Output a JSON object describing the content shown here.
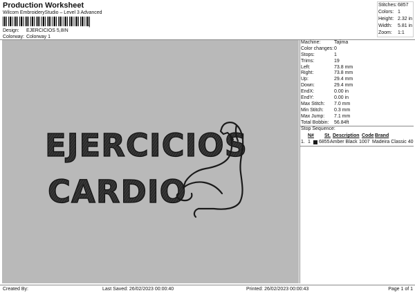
{
  "header": {
    "title": "Production Worksheet",
    "subtitle": "Wilcom EmbroideryStudio – Level 3 Advanced",
    "barcode_mark": ",",
    "design_label": "Design:",
    "design_value": "EJERCICIOS 5,8IN",
    "colorway_label": "Colorway:",
    "colorway_value": "Colorway 1"
  },
  "top_stats": [
    {
      "label": "Stitches:",
      "value": "6857"
    },
    {
      "label": "Colors:",
      "value": "1"
    },
    {
      "label": "Height:",
      "value": "2.32 in"
    },
    {
      "label": "Width:",
      "value": "5.81 in"
    },
    {
      "label": "Zoom:",
      "value": "1:1"
    }
  ],
  "design": {
    "line1": "EJERCICIOS",
    "line2": "CARDIO",
    "background": "#b9b9b9",
    "thread_color": "#2b2b2b",
    "arm_icon": "flexed-arm-icon"
  },
  "machine_info": [
    {
      "label": "Machine:",
      "value": "Tajima"
    },
    {
      "label": "Color changes:",
      "value": "0"
    },
    {
      "label": "Stops:",
      "value": "1"
    },
    {
      "label": "Trims:",
      "value": "19"
    },
    {
      "label": "Left:",
      "value": "73.8 mm"
    },
    {
      "label": "Right:",
      "value": "73.8 mm"
    },
    {
      "label": "Up:",
      "value": "29.4 mm"
    },
    {
      "label": "Down:",
      "value": "29.4 mm"
    },
    {
      "label": "EndX:",
      "value": "0.00 in"
    },
    {
      "label": "EndY:",
      "value": "0.00 in"
    },
    {
      "label": "Max Stitch:",
      "value": "7.0 mm"
    },
    {
      "label": "Min Stitch:",
      "value": "0.3 mm"
    },
    {
      "label": "Max Jump:",
      "value": "7.1 mm"
    },
    {
      "label": "Total Bobbin:",
      "value": "56.84ft"
    }
  ],
  "stop_sequence": {
    "title": "Stop Sequence:",
    "headers": {
      "n": "N#",
      "st": "St.",
      "description": "Description",
      "code": "Code",
      "brand": "Brand"
    },
    "rows": [
      {
        "index": "1.",
        "n": "1",
        "st": "6855",
        "description": "Amber Black",
        "code": "1007",
        "brand": "Madeira Classic 40",
        "color": "#1a1a1a"
      }
    ]
  },
  "footer": {
    "created_by": "Created By:",
    "last_saved": "Last Saved: 26/02/2023 00:00:40",
    "printed": "Printed: 26/02/2023 00:00:43",
    "page": "Page 1 of 1"
  }
}
